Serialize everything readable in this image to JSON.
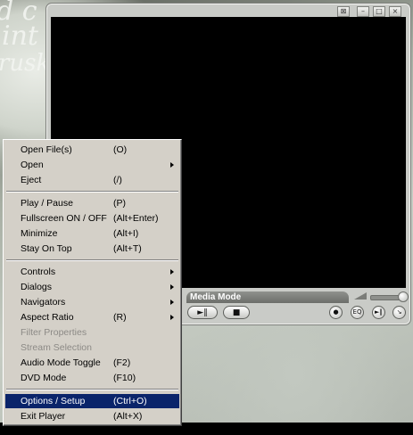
{
  "menu": {
    "groups": [
      [
        {
          "label": "Open File(s)",
          "shortcut": "(O)",
          "submenu": false,
          "enabled": true,
          "selected": false
        },
        {
          "label": "Open",
          "shortcut": "",
          "submenu": true,
          "enabled": true,
          "selected": false
        },
        {
          "label": "Eject",
          "shortcut": "(/)",
          "submenu": false,
          "enabled": true,
          "selected": false
        }
      ],
      [
        {
          "label": "Play / Pause",
          "shortcut": "(P)",
          "submenu": false,
          "enabled": true,
          "selected": false
        },
        {
          "label": "Fullscreen ON / OFF",
          "shortcut": "(Alt+Enter)",
          "submenu": false,
          "enabled": true,
          "selected": false
        },
        {
          "label": "Minimize",
          "shortcut": "(Alt+I)",
          "submenu": false,
          "enabled": true,
          "selected": false
        },
        {
          "label": "Stay On Top",
          "shortcut": "(Alt+T)",
          "submenu": false,
          "enabled": true,
          "selected": false
        }
      ],
      [
        {
          "label": "Controls",
          "shortcut": "",
          "submenu": true,
          "enabled": true,
          "selected": false
        },
        {
          "label": "Dialogs",
          "shortcut": "",
          "submenu": true,
          "enabled": true,
          "selected": false
        },
        {
          "label": "Navigators",
          "shortcut": "",
          "submenu": true,
          "enabled": true,
          "selected": false
        },
        {
          "label": "Aspect Ratio",
          "shortcut": "(R)",
          "submenu": true,
          "enabled": true,
          "selected": false
        },
        {
          "label": "Filter Properties",
          "shortcut": "",
          "submenu": false,
          "enabled": false,
          "selected": false
        },
        {
          "label": "Stream Selection",
          "shortcut": "",
          "submenu": false,
          "enabled": false,
          "selected": false
        },
        {
          "label": "Audio Mode Toggle",
          "shortcut": "(F2)",
          "submenu": false,
          "enabled": true,
          "selected": false
        },
        {
          "label": "DVD Mode",
          "shortcut": "(F10)",
          "submenu": false,
          "enabled": true,
          "selected": false
        }
      ],
      [
        {
          "label": "Options / Setup",
          "shortcut": "(Ctrl+O)",
          "submenu": false,
          "enabled": true,
          "selected": true
        },
        {
          "label": "Exit Player",
          "shortcut": "(Alt+X)",
          "submenu": false,
          "enabled": true,
          "selected": false
        }
      ]
    ]
  },
  "player": {
    "window_buttons": [
      "⊠",
      "–",
      "□",
      "×"
    ],
    "mode_label": "Media Mode",
    "buttons": {
      "play_pause": "►‖",
      "stop": "■",
      "b1": "●",
      "b2": "EQ",
      "b3": "►‖",
      "b4": "↘"
    }
  },
  "wallpaper": {
    "texts": [
      "d c",
      "int",
      "rusk"
    ]
  },
  "colors": {
    "menu_bg": "#d4d0c8",
    "menu_highlight": "#0a246a",
    "video_bg": "#000000"
  }
}
